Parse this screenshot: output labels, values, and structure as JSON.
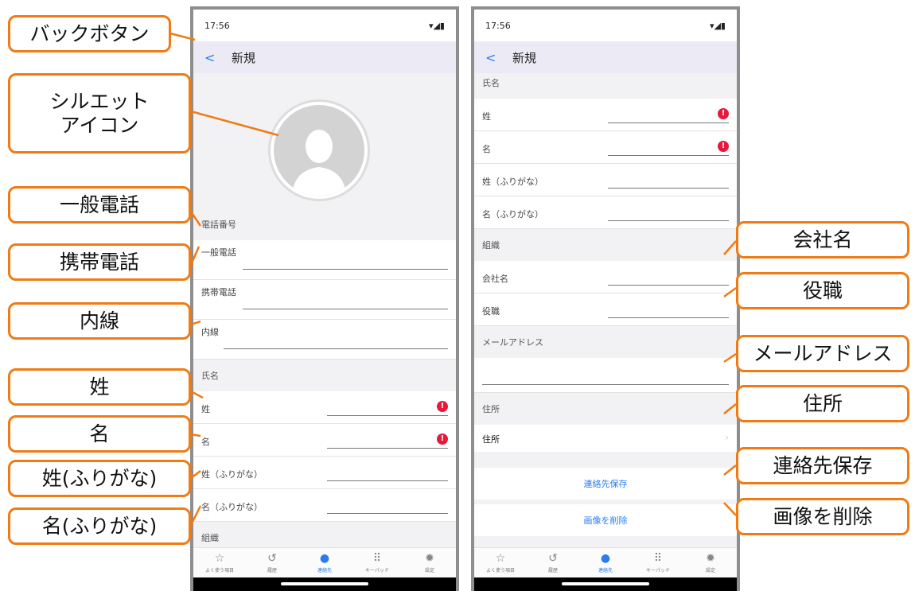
{
  "callouts": {
    "back_button": "バックボタン",
    "silhouette_line1": "シルエット",
    "silhouette_line2": "アイコン",
    "general_phone": "一般電話",
    "mobile_phone": "携帯電話",
    "extension": "内線",
    "last_name": "姓",
    "first_name": "名",
    "last_name_kana": "姓(ふりがな)",
    "first_name_kana": "名(ふりがな)",
    "company": "会社名",
    "title": "役職",
    "email": "メールアドレス",
    "address": "住所",
    "save_contact": "連絡先保存",
    "delete_image": "画像を削除"
  },
  "status": {
    "time": "17:56"
  },
  "nav": {
    "back_icon": "chevron-left-icon",
    "title": "新規"
  },
  "screen1": {
    "phone_section": "電話番号",
    "general_phone": "一般電話",
    "mobile_phone": "携帯電話",
    "extension": "内線",
    "name_section": "氏名",
    "last_name": "姓",
    "first_name": "名",
    "last_name_kana": "姓（ふりがな）",
    "first_name_kana": "名（ふりがな）",
    "org_section": "組織"
  },
  "screen2": {
    "name_section": "氏名",
    "last_name": "姓",
    "first_name": "名",
    "last_name_kana": "姓（ふりがな）",
    "first_name_kana": "名（ふりがな）",
    "org_section": "組織",
    "company": "会社名",
    "title": "役職",
    "email_section": "メールアドレス",
    "address_section": "住所",
    "address": "住所",
    "save_button": "連絡先保存",
    "delete_image_button": "画像を削除"
  },
  "tabs": [
    {
      "label": "よく使う項目",
      "icon": "star-icon"
    },
    {
      "label": "履歴",
      "icon": "history-icon"
    },
    {
      "label": "連絡先",
      "icon": "person-icon"
    },
    {
      "label": "キーパッド",
      "icon": "keypad-icon"
    },
    {
      "label": "設定",
      "icon": "gear-icon"
    }
  ],
  "colors": {
    "accent": "#f07b14",
    "link": "#2b7cf0",
    "error": "#e8183a"
  }
}
